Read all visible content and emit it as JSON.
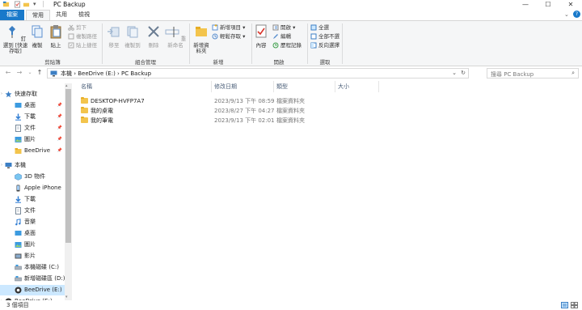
{
  "window": {
    "title": "PC Backup"
  },
  "window_controls": {
    "minimize": "—",
    "maximize": "☐",
    "close": "✕"
  },
  "tabs": [
    "檔案",
    "常用",
    "共用",
    "檢視"
  ],
  "ribbon": {
    "clipboard": {
      "pin_quick_access": "釘選到 [快速存取]",
      "copy": "複製",
      "paste": "貼上",
      "cut": "剪下",
      "copy_path": "複製路徑",
      "paste_shortcut": "貼上捷徑",
      "label": "剪貼簿"
    },
    "organize": {
      "move_to": "移至",
      "copy_to": "複製到",
      "delete": "刪除",
      "rename": "重新命名",
      "label": "組合管理"
    },
    "new": {
      "new_folder": "新增資料夾",
      "new_item": "新增項目",
      "easy_access": "輕鬆存取",
      "label": "新增"
    },
    "open": {
      "properties": "內容",
      "open": "開啟",
      "edit": "編輯",
      "history": "歷程記錄",
      "label": "開啟"
    },
    "select": {
      "select_all": "全選",
      "select_none": "全部不選",
      "invert": "反向選擇",
      "label": "選取"
    }
  },
  "address": {
    "crumbs": "本機  ›  BeeDrive (E:)  ›  PC Backup"
  },
  "search": {
    "placeholder": "搜尋 PC Backup"
  },
  "nav": [
    {
      "label": "快速存取",
      "icon": "star-icon",
      "pinned": false,
      "indent": 0
    },
    {
      "label": "桌面",
      "icon": "desktop-icon",
      "pinned": true,
      "indent": 1
    },
    {
      "label": "下載",
      "icon": "download-icon",
      "pinned": true,
      "indent": 1
    },
    {
      "label": "文件",
      "icon": "document-icon",
      "pinned": true,
      "indent": 1
    },
    {
      "label": "圖片",
      "icon": "picture-icon",
      "pinned": true,
      "indent": 1
    },
    {
      "label": "BeeDrive",
      "icon": "folder-icon",
      "pinned": true,
      "indent": 1
    },
    {
      "label": "本機",
      "icon": "computer-icon",
      "pinned": false,
      "indent": 0
    },
    {
      "label": "3D 物件",
      "icon": "cube-icon",
      "pinned": false,
      "indent": 1
    },
    {
      "label": "Apple iPhone",
      "icon": "phone-icon",
      "pinned": false,
      "indent": 1
    },
    {
      "label": "下載",
      "icon": "download-icon",
      "pinned": false,
      "indent": 1
    },
    {
      "label": "文件",
      "icon": "document-icon",
      "pinned": false,
      "indent": 1
    },
    {
      "label": "音樂",
      "icon": "music-icon",
      "pinned": false,
      "indent": 1
    },
    {
      "label": "桌面",
      "icon": "desktop-icon",
      "pinned": false,
      "indent": 1
    },
    {
      "label": "圖片",
      "icon": "picture-icon",
      "pinned": false,
      "indent": 1
    },
    {
      "label": "影片",
      "icon": "video-icon",
      "pinned": false,
      "indent": 1
    },
    {
      "label": "本機磁碟 (C:)",
      "icon": "drive-icon",
      "pinned": false,
      "indent": 1
    },
    {
      "label": "新增磁碟區 (D:)",
      "icon": "drive-icon",
      "pinned": false,
      "indent": 1
    },
    {
      "label": "BeeDrive (E:)",
      "icon": "beedrive-icon",
      "pinned": false,
      "indent": 1,
      "selected": true
    },
    {
      "label": "BeeDrive (E:)",
      "icon": "beedrive-icon",
      "pinned": false,
      "indent": 0
    }
  ],
  "columns": {
    "name": "名稱",
    "modified": "修改日期",
    "type": "類型",
    "size": "大小"
  },
  "files": [
    {
      "name": "DESKTOP-HVFP7A7",
      "modified": "2023/9/13 下午 08:59",
      "type": "檔案資料夾",
      "size": ""
    },
    {
      "name": "我的桌電",
      "modified": "2023/8/27 下午 04:27",
      "type": "檔案資料夾",
      "size": ""
    },
    {
      "name": "我的筆電",
      "modified": "2023/9/13 下午 02:01",
      "type": "檔案資料夾",
      "size": ""
    }
  ],
  "status": {
    "count": "3 個項目"
  },
  "colors": {
    "accent": "#1979ca",
    "selection": "#cce8ff",
    "folder": "#f3c44c"
  }
}
